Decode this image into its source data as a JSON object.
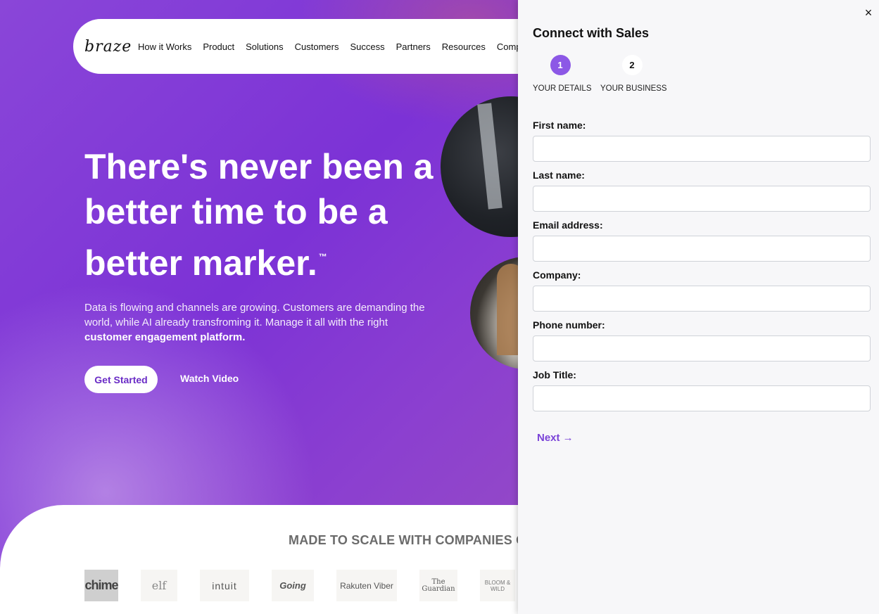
{
  "nav": {
    "logo": "braze",
    "links": [
      "How it Works",
      "Product",
      "Solutions",
      "Customers",
      "Success",
      "Partners",
      "Resources",
      "Company"
    ]
  },
  "hero": {
    "headline": "There's never been a better time to be a better marker.",
    "trademark": "™",
    "subtext": "Data is flowing and channels are growing. Customers are demanding the world, while AI already transfroming it. Manage it all with the right",
    "subtext_bold": "customer engagement platform.",
    "primary_cta": "Get Started",
    "secondary_cta": "Watch Video"
  },
  "scale": {
    "title": "MADE TO SCALE WITH COMPANIES O",
    "logos": [
      "chime",
      "elf",
      "intuit",
      "Going",
      "Rakuten Viber",
      "The Guardian",
      "BLOOM & WILD"
    ]
  },
  "panel": {
    "close": "×",
    "title": "Connect with Sales",
    "steps": [
      {
        "number": "1",
        "label": "YOUR DETAILS"
      },
      {
        "number": "2",
        "label": "YOUR BUSINESS"
      }
    ],
    "fields": [
      {
        "label": "First name:",
        "value": ""
      },
      {
        "label": "Last name:",
        "value": ""
      },
      {
        "label": "Email address:",
        "value": ""
      },
      {
        "label": "Company:",
        "value": ""
      },
      {
        "label": "Phone number:",
        "value": ""
      },
      {
        "label": "Job Title:",
        "value": ""
      }
    ],
    "next": "Next →"
  },
  "colors": {
    "accent": "#8c58e6",
    "brand_purple": "#7c32d6",
    "link_purple": "#7a43d8"
  }
}
